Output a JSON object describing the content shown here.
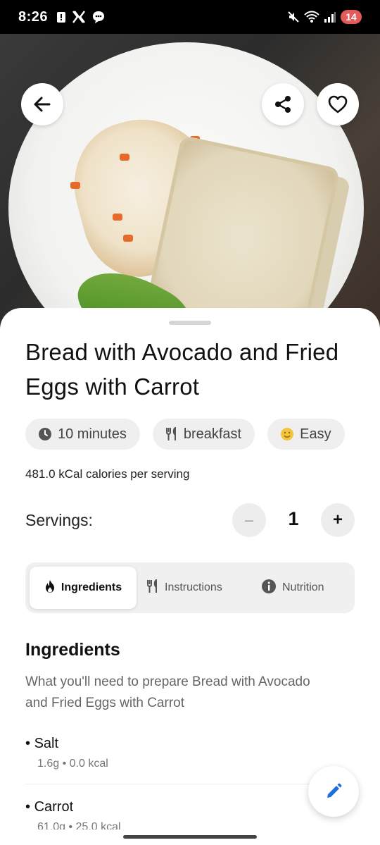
{
  "status_bar": {
    "time": "8:26",
    "battery": "14"
  },
  "recipe": {
    "title": "Bread with Avocado and Fried Eggs with Carrot",
    "chips": {
      "time": "10 minutes",
      "meal": "breakfast",
      "difficulty": "Easy"
    },
    "calories": "481.0 kCal calories per serving"
  },
  "servings": {
    "label": "Servings:",
    "value": "1",
    "minus": "–",
    "plus": "+"
  },
  "tabs": [
    {
      "label": "Ingredients",
      "icon": "flame-icon",
      "active": true
    },
    {
      "label": "Instructions",
      "icon": "fork-knife-icon",
      "active": false
    },
    {
      "label": "Nutrition",
      "icon": "info-icon",
      "active": false
    }
  ],
  "ingredients_section": {
    "title": "Ingredients",
    "subtitle": "What you'll need to prepare Bread with Avocado and Fried Eggs with Carrot",
    "items": [
      {
        "name": "Salt",
        "meta": "1.6g • 0.0 kcal"
      },
      {
        "name": "Carrot",
        "meta": "61.0g • 25.0 kcal"
      }
    ]
  },
  "colors": {
    "accent": "#1e6fd9",
    "chip_bg": "#efefef",
    "difficulty_icon": "#f2c53d",
    "battery_badge": "#e35a5a"
  }
}
